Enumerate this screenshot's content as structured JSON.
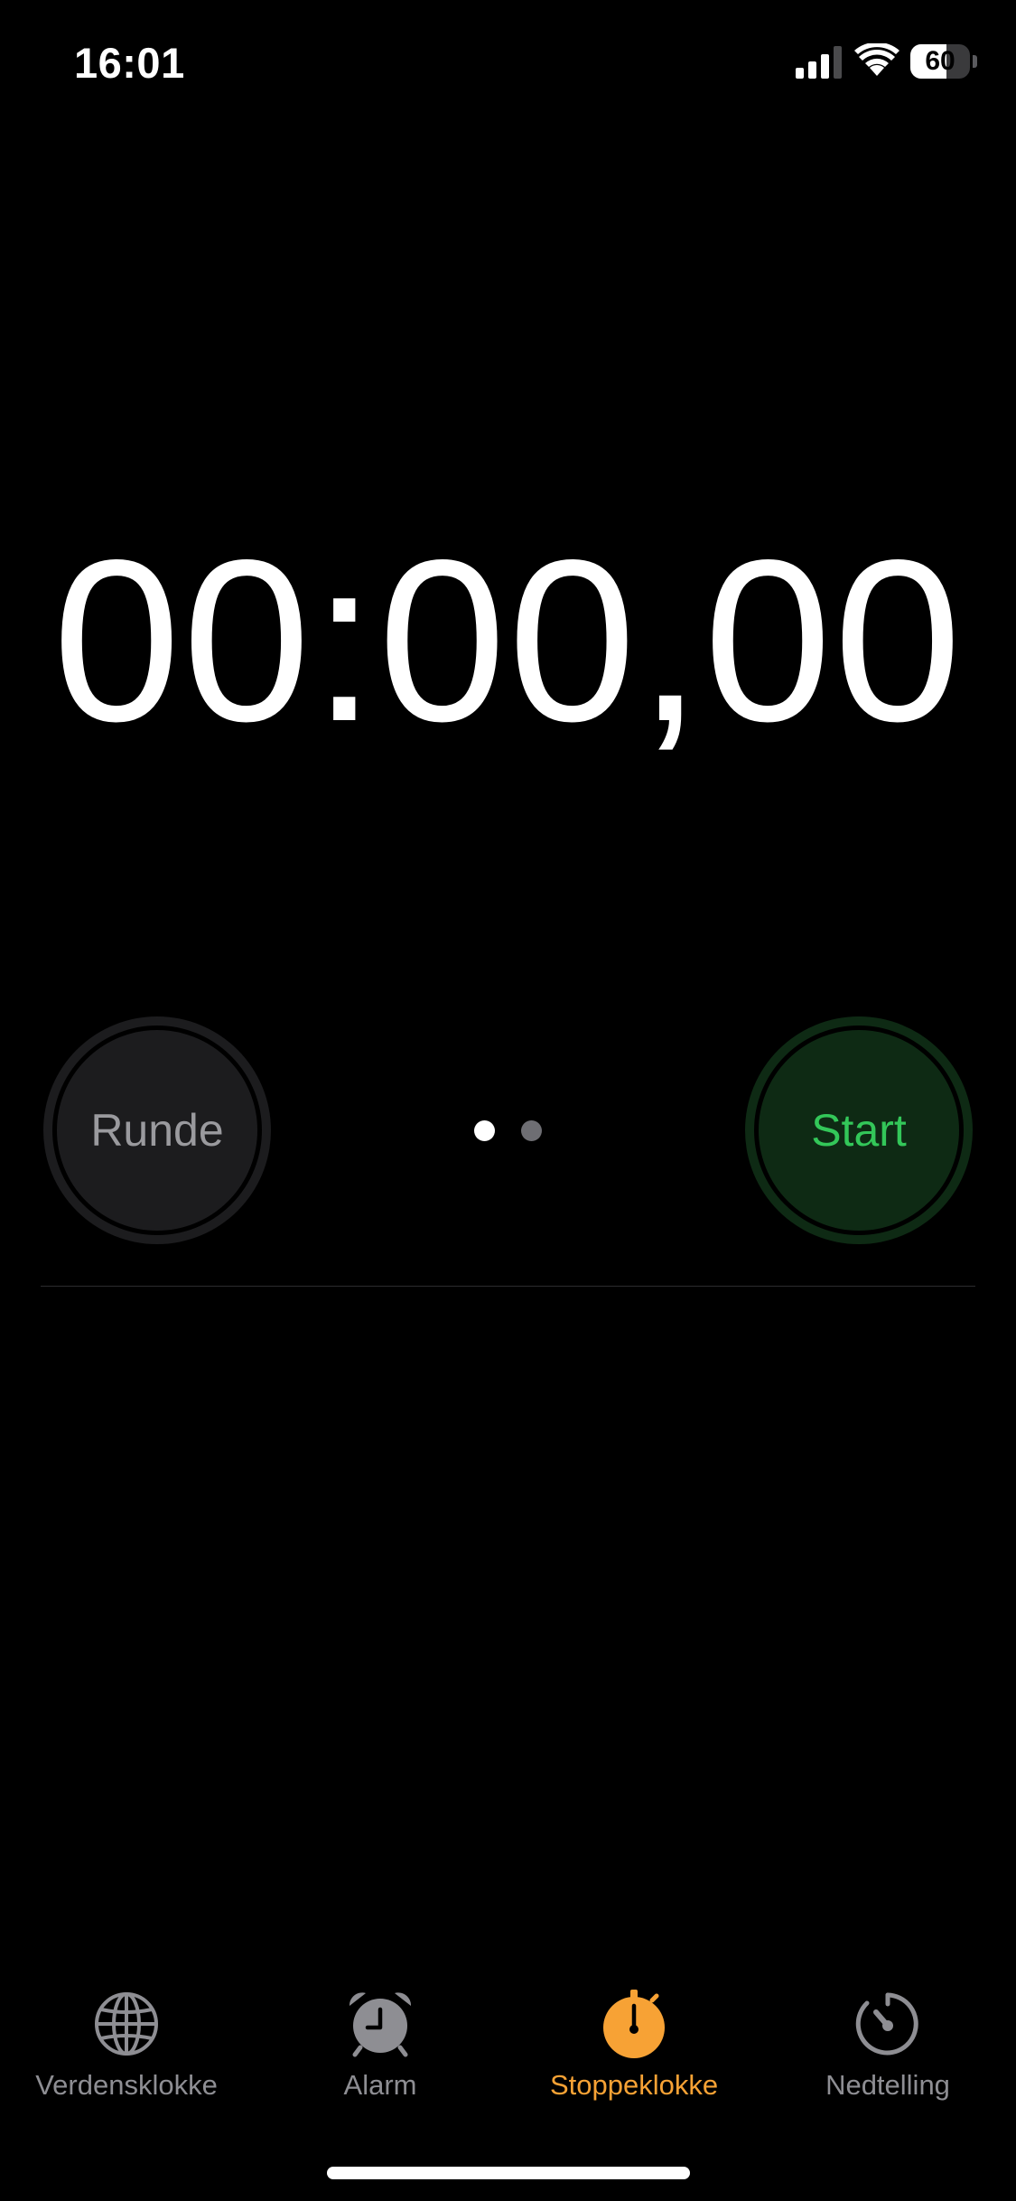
{
  "status_bar": {
    "time": "16:01",
    "battery_level": "60",
    "battery_fraction": 0.6,
    "signal_bars": 3,
    "icons": [
      "signal-icon",
      "wifi-icon",
      "battery-icon"
    ]
  },
  "stopwatch": {
    "display": "00:00,00"
  },
  "controls": {
    "lap_label": "Runde",
    "start_label": "Start",
    "page_count": 2,
    "active_page": 0
  },
  "tabs": [
    {
      "label": "Verdensklokke",
      "icon": "globe-icon",
      "active": false
    },
    {
      "label": "Alarm",
      "icon": "alarm-clock-icon",
      "active": false
    },
    {
      "label": "Stoppeklokke",
      "icon": "stopwatch-icon",
      "active": true
    },
    {
      "label": "Nedtelling",
      "icon": "timer-icon",
      "active": false
    }
  ],
  "colors": {
    "background": "#000000",
    "accent": "#f7a235",
    "start_text": "#33c759",
    "start_bg": "#0e2a14",
    "lap_text": "#9a9a9e",
    "lap_bg": "#1c1c1e",
    "tab_inactive": "#8e8e93"
  }
}
